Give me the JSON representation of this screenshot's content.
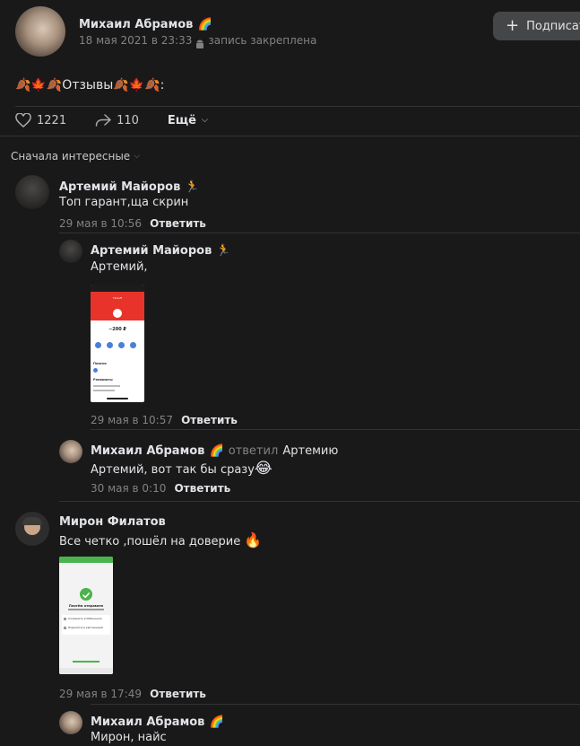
{
  "post": {
    "author": "Михаил Абрамов",
    "author_emoji": "🌈",
    "date": "18 мая 2021 в 23:33",
    "pinned_label": "запись закреплена",
    "subscribe_label": "Подписаться",
    "text_prefix": "🍂🍁🍂",
    "text_main": "Отзывы",
    "text_suffix": "🍂🍁🍂:",
    "likes": "1221",
    "shares": "110",
    "more_label": "Ещё"
  },
  "sort_label": "Сначала интересные",
  "comments": [
    {
      "author": "Артемий Майоров",
      "emoji": "🏃",
      "text": "Топ гарант,ща скрин",
      "date": "29 мая в 10:56",
      "reply": "Ответить"
    },
    {
      "author": "Артемий Майоров",
      "emoji": "🏃",
      "text": "Артемий,",
      "date": "29 мая в 10:57",
      "reply": "Ответить",
      "shot": {
        "top_text": "Tinkoff",
        "amount": "−200 ₽",
        "section1": "Поиски",
        "section2": "Реквизиты"
      }
    },
    {
      "author": "Михаил Абрамов",
      "emoji": "🌈",
      "answered": "ответил",
      "answered_to": "Артемию",
      "text": "Артемий, вот так бы сразу",
      "text_emoji": "😂",
      "date": "30 мая в 0:10",
      "reply": "Ответить"
    },
    {
      "author": "Мирон Филатов",
      "text": "Все четко ,пошёл на доверие",
      "text_emoji": "🔥",
      "date": "29 мая в 17:49",
      "reply": "Ответить",
      "shot": {
        "title": "Платёж отправлен",
        "row1": "Сохранить в Избранное",
        "row2": "Поделиться квитанцией"
      }
    },
    {
      "author": "Михаил Абрамов",
      "emoji": "🌈",
      "text": "Мирон, найс"
    }
  ],
  "colors": {
    "background": "#19191a",
    "text": "#e1e3e6",
    "meta": "#828282",
    "accent_red": "#e8332a",
    "accent_green": "#4bb34b"
  }
}
